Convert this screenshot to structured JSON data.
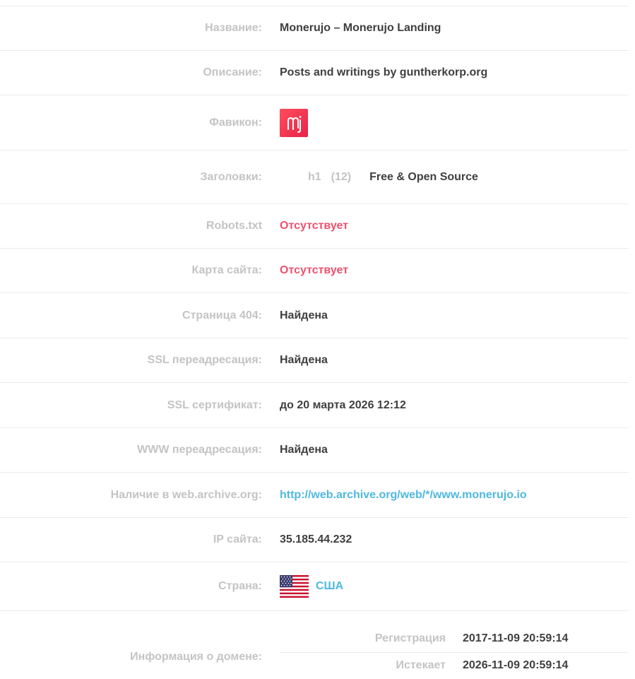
{
  "rows": {
    "title": {
      "label": "Название:",
      "value": "Monerujo – Monerujo Landing"
    },
    "description": {
      "label": "Описание:",
      "value": "Posts and writings by guntherkorp.org"
    },
    "favicon": {
      "label": "Фавикон:",
      "icon": "monerujo-favicon-icon",
      "glyph": "mj"
    },
    "headings": {
      "label": "Заголовки:",
      "tag": "h1",
      "count": "(12)",
      "text": "Free & Open Source"
    },
    "robots": {
      "label": "Robots.txt",
      "value": "Отсутствует"
    },
    "sitemap": {
      "label": "Карта сайта:",
      "value": "Отсутствует"
    },
    "page404": {
      "label": "Страница 404:",
      "value": "Найдена"
    },
    "ssl_redirect": {
      "label": "SSL переадресация:",
      "value": "Найдена"
    },
    "ssl_cert": {
      "label": "SSL сертификат:",
      "value": "до 20 марта 2026 12:12"
    },
    "www_redirect": {
      "label": "WWW переадресация:",
      "value": "Найдена"
    },
    "archive": {
      "label": "Наличие в web.archive.org:",
      "value": "http://web.archive.org/web/*/www.monerujo.io"
    },
    "ip": {
      "label": "IP сайта:",
      "value": "35.185.44.232"
    },
    "country": {
      "label": "Страна:",
      "value": "США",
      "flag": "us-flag-icon"
    },
    "domain": {
      "label": "Информация о домене:",
      "registration_label": "Регистрация",
      "registration_value": "2017-11-09 20:59:14",
      "expires_label": "Истекает",
      "expires_value": "2026-11-09 20:59:14"
    }
  },
  "colors": {
    "label": "#c4c4c4",
    "value": "#3f3f3f",
    "missing": "#f0506e",
    "link": "#4fb8e0",
    "divider": "#ebebeb"
  }
}
